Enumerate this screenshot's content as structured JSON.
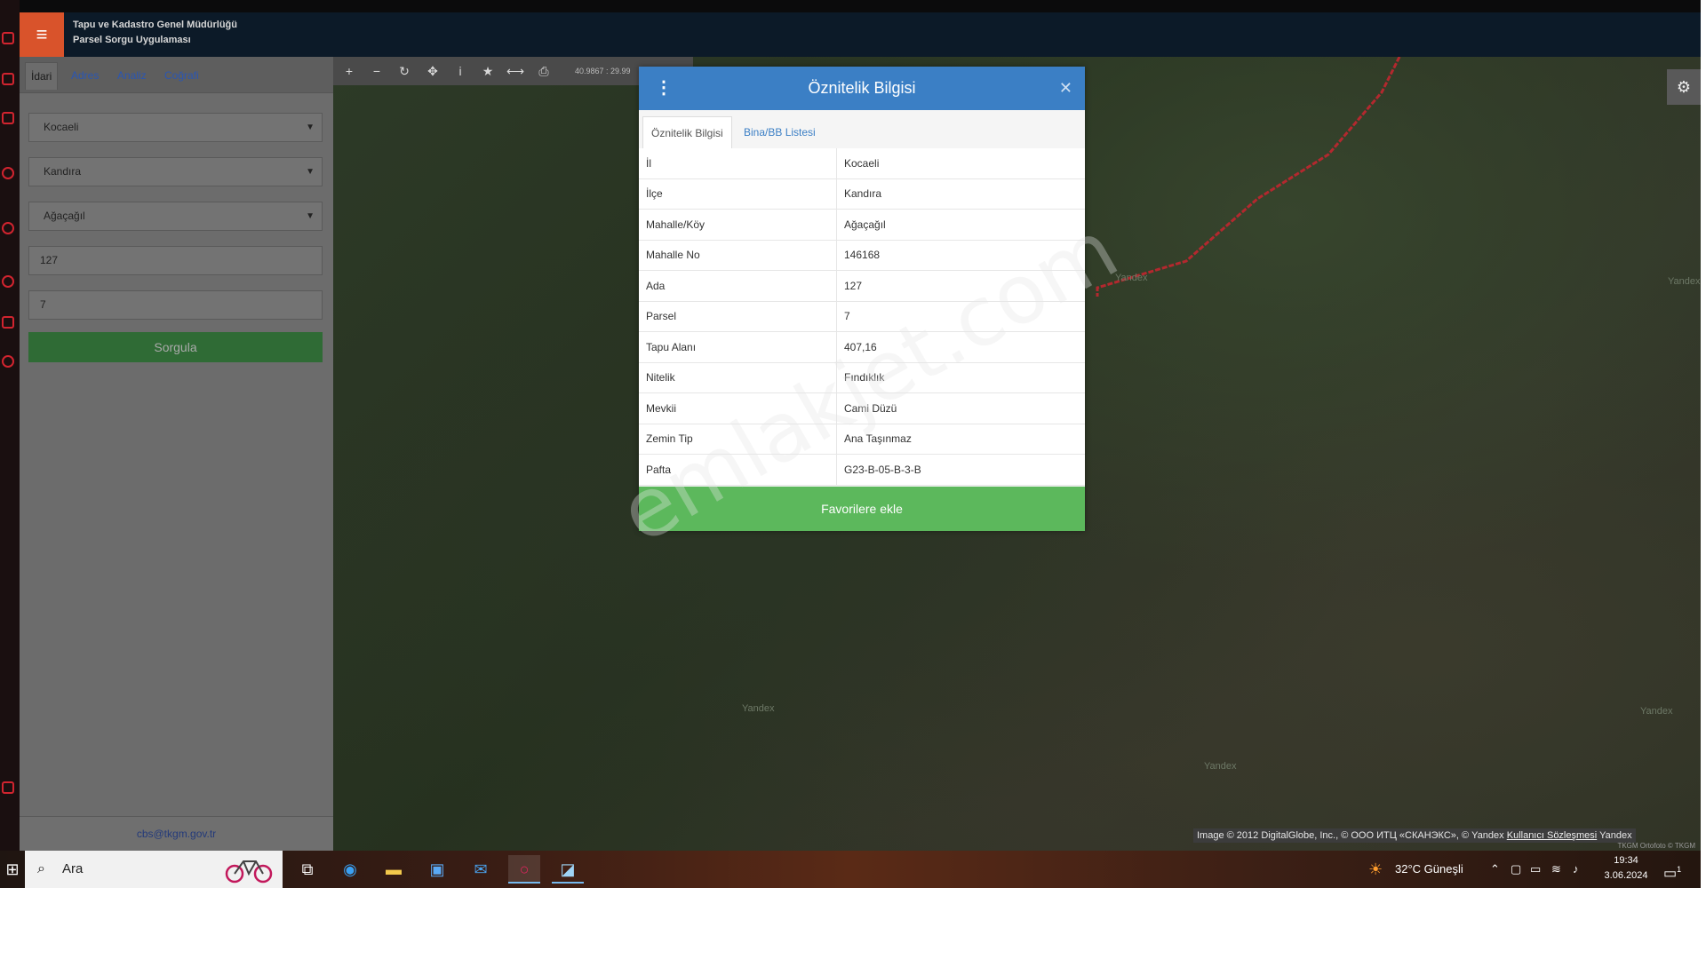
{
  "header": {
    "title_line1": "Tapu ve Kadastro Genel Müdürlüğü",
    "title_line2": "Parsel Sorgu Uygulaması",
    "menu_icon": "hamburger-icon"
  },
  "side_panel": {
    "tabs": [
      "İdari",
      "Adres",
      "Analiz",
      "Coğrafi"
    ],
    "active_tab": "İdari",
    "il": "Kocaeli",
    "ilce": "Kandıra",
    "mahalle": "Ağaçağıl",
    "ada": "127",
    "parsel": "7",
    "search_button": "Sorgula",
    "footer_email": "cbs@tkgm.gov.tr"
  },
  "map_toolbar": {
    "icons": [
      "zoom-in-icon",
      "zoom-out-icon",
      "refresh-icon",
      "locate-icon",
      "info-icon",
      "star-icon",
      "measure-icon",
      "print-icon"
    ],
    "coordinates": "40.9867 : 29.99"
  },
  "map": {
    "watermark": "emlakjet.com",
    "yandex_label": "Yandex",
    "attribution_text": "Image © 2012 DigitalGlobe, Inc., © ООО ИТЦ «СКАНЭКС», © Yandex",
    "attribution_link": "Kullanıcı Sözleşmesi",
    "attribution_brand": "Yandex",
    "ortofoto_text": "TKGM Ortofoto © TKGM"
  },
  "modal": {
    "title": "Öznitelik Bilgisi",
    "tabs": [
      "Öznitelik Bilgisi",
      "Bina/BB Listesi"
    ],
    "rows": [
      {
        "key": "İl",
        "value": "Kocaeli"
      },
      {
        "key": "İlçe",
        "value": "Kandıra"
      },
      {
        "key": "Mahalle/Köy",
        "value": "Ağaçağıl"
      },
      {
        "key": "Mahalle No",
        "value": "146168"
      },
      {
        "key": "Ada",
        "value": "127"
      },
      {
        "key": "Parsel",
        "value": "7"
      },
      {
        "key": "Tapu Alanı",
        "value": "407,16"
      },
      {
        "key": "Nitelik",
        "value": "Fındıklık"
      },
      {
        "key": "Mevkii",
        "value": "Cami Düzü"
      },
      {
        "key": "Zemin Tip",
        "value": "Ana Taşınmaz"
      },
      {
        "key": "Pafta",
        "value": "G23-B-05-B-3-B"
      }
    ],
    "favorite_button": "Favorilere ekle"
  },
  "taskbar": {
    "search_placeholder": "Ara",
    "weather": "32°C  Güneşli",
    "time": "19:34",
    "date": "3.06.2024",
    "notification_count": "1"
  },
  "colors": {
    "accent_orange": "#d9532b",
    "modal_blue": "#3b7fc5",
    "favorite_green": "#5cb85c",
    "query_green": "#2f6b35"
  }
}
